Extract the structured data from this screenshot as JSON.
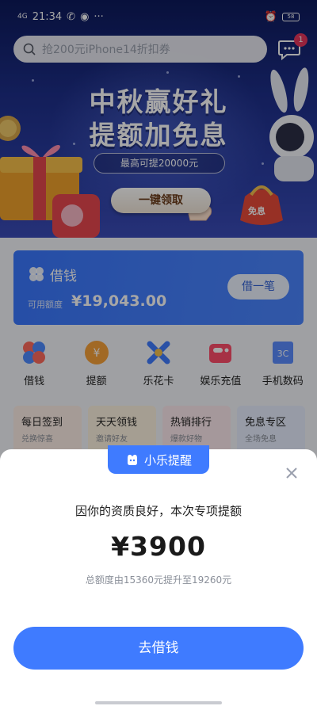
{
  "status_bar": {
    "time": "21:34",
    "signal": "4G",
    "battery": "58"
  },
  "search": {
    "placeholder": "抢200元iPhone14折扣券"
  },
  "messages": {
    "badge_count": "1"
  },
  "banner": {
    "title_line1": "中秋赢好礼",
    "title_line2": "提额加免息",
    "subtitle": "最高可提20000元",
    "claim_button": "一键领取",
    "coupon_label": "免息"
  },
  "loan_card": {
    "title": "借钱",
    "available_label": "可用额度",
    "available_value": "¥19,043.00",
    "borrow_button": "借一笔"
  },
  "quick_actions": [
    {
      "label": "借钱",
      "icon": "clover-icon"
    },
    {
      "label": "提额",
      "icon": "yuan-coin-icon"
    },
    {
      "label": "乐花卡",
      "icon": "star-card-icon"
    },
    {
      "label": "娱乐充值",
      "icon": "game-icon"
    },
    {
      "label": "手机数码",
      "icon": "digital-3c-icon"
    }
  ],
  "promos": [
    {
      "title": "每日签到",
      "subtitle": "兑换惊喜",
      "bg": "#fdeee6"
    },
    {
      "title": "天天领钱",
      "subtitle": "邀请好友",
      "bg": "#fef3e0"
    },
    {
      "title": "热销排行",
      "subtitle": "爆款好物",
      "bg": "#fdeaee"
    },
    {
      "title": "免息专区",
      "subtitle": "全场免息",
      "bg": "#e8efff"
    }
  ],
  "sheet": {
    "tag": "小乐提醒",
    "message": "因你的资质良好，本次专项提额",
    "amount": "¥3900",
    "detail": "总额度由15360元提升至19260元",
    "cta": "去借钱"
  },
  "colors": {
    "accent": "#3f7bff",
    "badge": "#e8365d",
    "banner_dark": "#1e2f8a"
  }
}
